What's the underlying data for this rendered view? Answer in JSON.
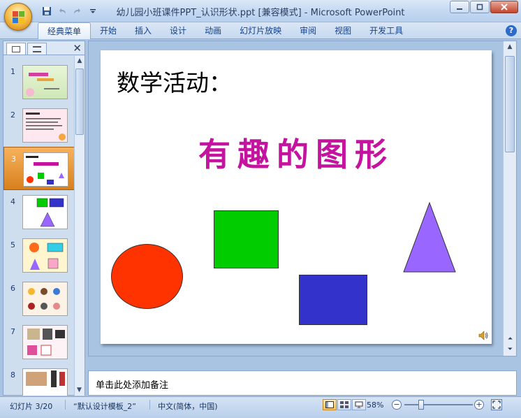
{
  "window": {
    "title": "幼儿园小班课件PPT_认识形状.ppt [兼容模式] - Microsoft PowerPoint",
    "minimize_icon": "minimize-icon",
    "maximize_icon": "maximize-icon",
    "close_icon": "close-icon"
  },
  "quick_access": [
    "save-icon",
    "undo-icon",
    "redo-icon",
    "customize-icon"
  ],
  "ribbon": {
    "tabs": [
      {
        "label": "经典菜单",
        "active": true
      },
      {
        "label": "开始"
      },
      {
        "label": "插入"
      },
      {
        "label": "设计"
      },
      {
        "label": "动画"
      },
      {
        "label": "幻灯片放映"
      },
      {
        "label": "审阅"
      },
      {
        "label": "视图"
      },
      {
        "label": "开发工具"
      }
    ],
    "help_label": "?"
  },
  "slides_panel": {
    "close_label": "✕",
    "thumbnails": [
      {
        "number": "1"
      },
      {
        "number": "2"
      },
      {
        "number": "3",
        "selected": true
      },
      {
        "number": "4"
      },
      {
        "number": "5"
      },
      {
        "number": "6"
      },
      {
        "number": "7"
      },
      {
        "number": "8"
      }
    ]
  },
  "slide": {
    "title": "数学活动：",
    "subtitle": "有趣的图形",
    "shapes": [
      {
        "name": "red-circle",
        "color": "#FF3300"
      },
      {
        "name": "green-square",
        "color": "#00CC00"
      },
      {
        "name": "blue-rectangle",
        "color": "#3333CC"
      },
      {
        "name": "purple-triangle",
        "color": "#9966FF"
      }
    ],
    "sound_icon": "speaker-icon"
  },
  "notes": {
    "placeholder": "单击此处添加备注"
  },
  "statusbar": {
    "slide_counter": "幻灯片 3/20",
    "theme": "“默认设计模板_2”",
    "language": "中文(简体，中国)",
    "zoom": "58%",
    "zoom_minus": "−",
    "zoom_plus": "+"
  },
  "colors": {
    "subtitle": "#C4139F",
    "ribbon_text": "#15428B",
    "selected_thumb": "#E8982F"
  }
}
